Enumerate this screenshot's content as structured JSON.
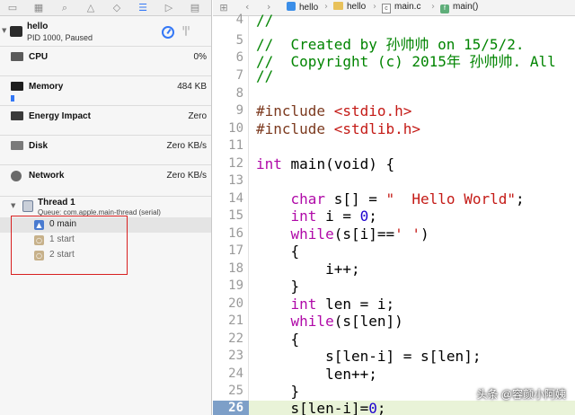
{
  "navigator": {
    "toolbar_icons": [
      {
        "name": "folder-icon",
        "glyph": "▭"
      },
      {
        "name": "symbol-icon",
        "glyph": "▦"
      },
      {
        "name": "search-icon",
        "glyph": "⌕"
      },
      {
        "name": "warning-icon",
        "glyph": "△"
      },
      {
        "name": "test-icon",
        "glyph": "◇"
      },
      {
        "name": "debug-icon",
        "glyph": "☰"
      },
      {
        "name": "breakpoint-icon",
        "glyph": "▷"
      },
      {
        "name": "report-icon",
        "glyph": "▤"
      }
    ],
    "process": {
      "name": "hello",
      "status": "PID 1000, Paused"
    },
    "gauges": [
      {
        "label": "CPU",
        "value": "0%"
      },
      {
        "label": "Memory",
        "value": "484 KB"
      },
      {
        "label": "Energy Impact",
        "value": "Zero"
      },
      {
        "label": "Disk",
        "value": "Zero KB/s"
      },
      {
        "label": "Network",
        "value": "Zero KB/s"
      }
    ],
    "thread": {
      "name": "Thread 1",
      "queue": "Queue: com.apple.main-thread (serial)"
    },
    "frames": [
      "0 main",
      "1 start",
      "2 start"
    ]
  },
  "jumpbar": {
    "back": "‹",
    "forward": "›",
    "path": [
      "hello",
      "hello",
      "main.c",
      "main()"
    ]
  },
  "editor": {
    "line_numbers": [
      "4",
      "5",
      "6",
      "7",
      "8",
      "9",
      "10",
      "11",
      "12",
      "13",
      "14",
      "15",
      "16",
      "17",
      "18",
      "19",
      "20",
      "21",
      "22",
      "23",
      "24",
      "25",
      "26"
    ],
    "current_line": "26",
    "lines": {
      "l4": "//",
      "l5": "//  Created by 孙帅帅 on 15/5/2.",
      "l6": "//  Copyright (c) 2015年 孙帅帅. All",
      "l7": "//",
      "l9_kw": "#include",
      "l9_hdr": " <stdio.h>",
      "l10_kw": "#include",
      "l10_hdr": " <stdlib.h>",
      "l12_kw": "int",
      "l12_rest": " main(void) {",
      "l14_indent": "    ",
      "l14_kw": "char",
      "l14_mid": " s[] = ",
      "l14_str": "\"  Hello World\"",
      "l14_end": ";",
      "l15_indent": "    ",
      "l15_kw": "int",
      "l15_mid": " i = ",
      "l15_num": "0",
      "l15_end": ";",
      "l16_indent": "    ",
      "l16_kw": "while",
      "l16_mid": "(s[i]==",
      "l16_str": "' '",
      "l16_end": ")",
      "l17": "    {",
      "l18": "        i++;",
      "l19": "    }",
      "l20_indent": "    ",
      "l20_kw": "int",
      "l20_rest": " len = i;",
      "l21_indent": "    ",
      "l21_kw": "while",
      "l21_rest": "(s[len])",
      "l22": "    {",
      "l23": "        s[len-i] = s[len];",
      "l24": "        len++;",
      "l25": "    }",
      "l26_code": "    s[len-i]=",
      "l26_num": "0",
      "l26_end": ";"
    }
  },
  "watermark": "头条 @容颜小阿姨",
  "colors": {
    "keyword": "#b00aa8",
    "string": "#c41a16",
    "comment": "#008400",
    "number": "#1c00cf",
    "preprocessor": "#7c3a1f",
    "highlight_box": "#d82020",
    "accent": "#3478f6"
  }
}
